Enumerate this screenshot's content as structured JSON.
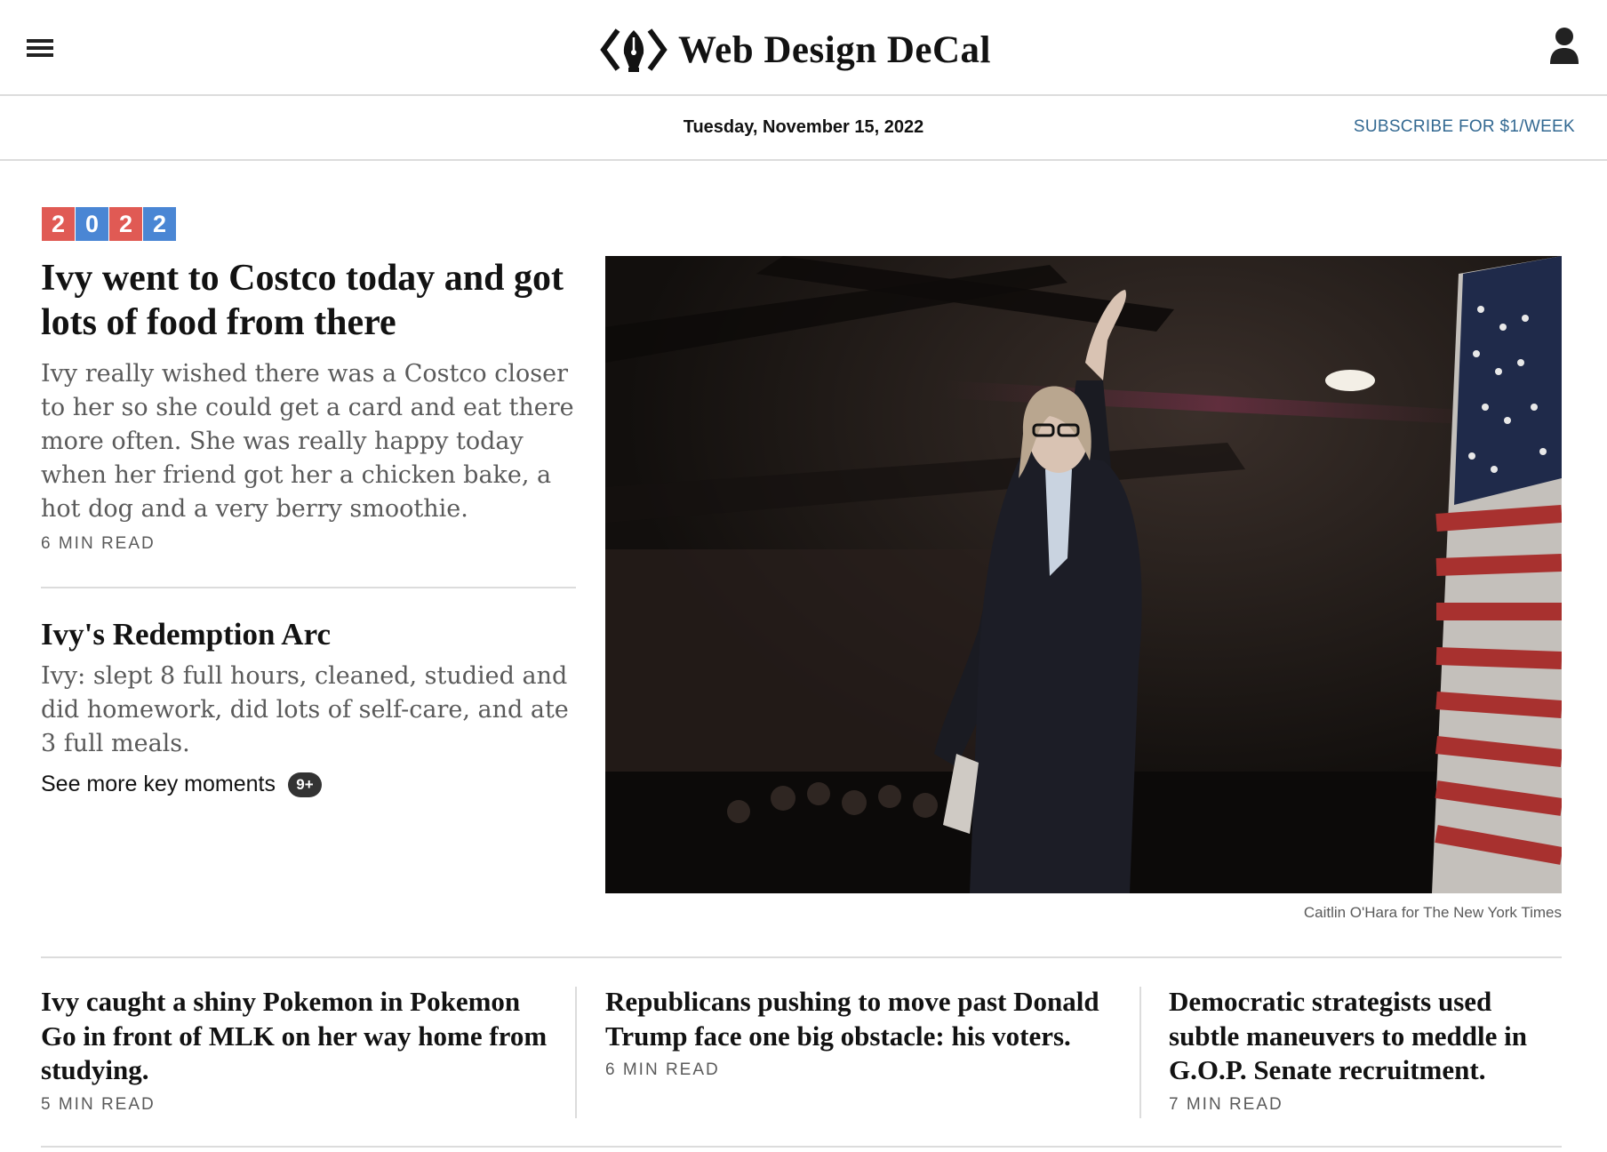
{
  "masthead": {
    "menu_icon": "hamburger-menu-icon",
    "logo_icon": "pen-nib-code-brackets-icon",
    "brand_name": "Web Design DeCal",
    "account_icon": "person-icon"
  },
  "datebar": {
    "date": "Tuesday, November 15, 2022",
    "subscribe_label": "SUBSCRIBE FOR $1/WEEK",
    "subscribe_color": "#326891"
  },
  "badge": {
    "digits": [
      "2",
      "0",
      "2",
      "2"
    ],
    "colors": [
      "#e05a54",
      "#4a86d4",
      "#e05a54",
      "#4a86d4"
    ]
  },
  "lead_story": {
    "headline": "Ivy went to Costco today and got lots of food from there",
    "summary": "Ivy really wished there was a Costco closer to her so she could get a card and eat there more often. She was really happy today when her friend got her a chicken bake, a hot dog and a very berry smoothie.",
    "read_time": "6 MIN READ"
  },
  "secondary_story": {
    "headline": "Ivy's Redemption Arc",
    "summary": "Ivy: slept 8 full hours, cleaned, studied and did homework, did lots of self-care, and ate 3 full meals.",
    "key_moments_label": "See more key moments",
    "key_moments_count": "9+"
  },
  "lead_photo": {
    "credit": "Caitlin O'Hara for The New York Times"
  },
  "bottom_stories": [
    {
      "headline": "Ivy caught a shiny Pokemon in Pokemon Go in front of MLK on her way home from studying.",
      "read_time": "5 MIN READ"
    },
    {
      "headline": "Republicans pushing to move past Donald Trump face one big obstacle: his voters.",
      "read_time": "6 MIN READ"
    },
    {
      "headline": "Democratic strategists used subtle maneuvers to meddle in G.O.P. Senate recruitment.",
      "read_time": "7 MIN READ"
    }
  ]
}
